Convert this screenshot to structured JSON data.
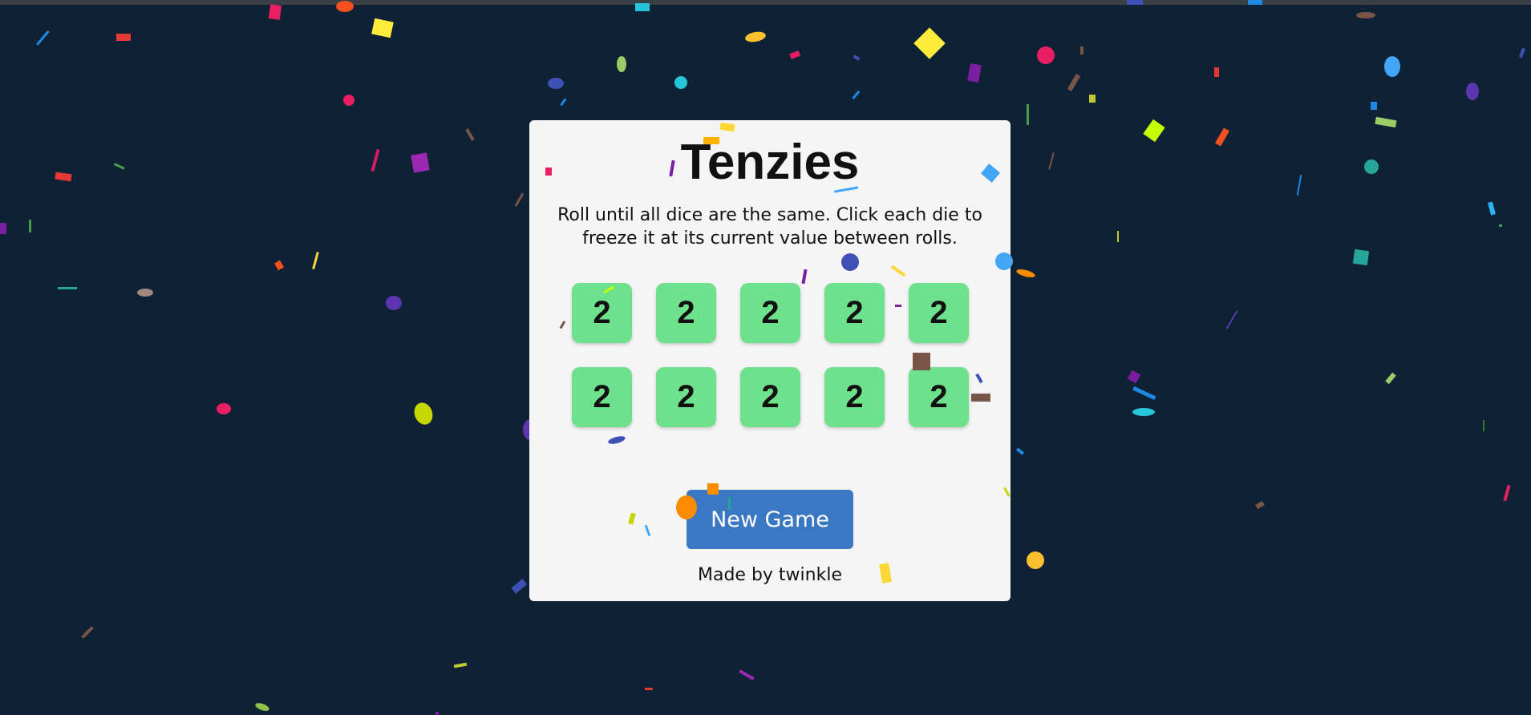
{
  "game": {
    "title": "Tenzies",
    "instructions": "Roll until all dice are the same. Click each die to freeze it at its current value between rolls.",
    "dice": [
      {
        "value": "2",
        "held": false
      },
      {
        "value": "2",
        "held": false
      },
      {
        "value": "2",
        "held": false
      },
      {
        "value": "2",
        "held": false
      },
      {
        "value": "2",
        "held": false
      },
      {
        "value": "2",
        "held": false
      },
      {
        "value": "2",
        "held": false
      },
      {
        "value": "2",
        "held": false
      },
      {
        "value": "2",
        "held": false
      },
      {
        "value": "2",
        "held": false
      }
    ],
    "new_game_label": "New Game",
    "credit": "Made by twinkle",
    "status": "won"
  },
  "colors": {
    "background": "#0f2235",
    "card": "#f5f5f5",
    "die": "#6ee18c",
    "button": "#3b78c4"
  }
}
